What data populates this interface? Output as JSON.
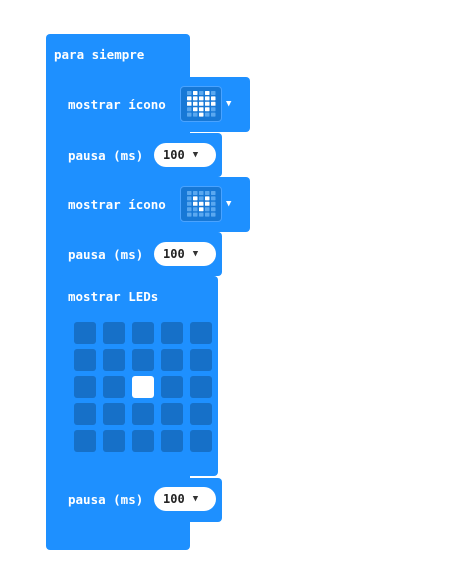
{
  "forever": {
    "label": "para siempre"
  },
  "blocks": [
    {
      "type": "show_icon",
      "label": "mostrar ícono",
      "icon": "heart-icon"
    },
    {
      "type": "pause",
      "label": "pausa (ms)",
      "value": "100"
    },
    {
      "type": "show_icon",
      "label": "mostrar ícono",
      "icon": "small-heart-icon"
    },
    {
      "type": "pause",
      "label": "pausa (ms)",
      "value": "100"
    },
    {
      "type": "show_leds",
      "label": "mostrar LEDs",
      "leds": [
        [
          0,
          0,
          0,
          0,
          0
        ],
        [
          0,
          0,
          0,
          0,
          0
        ],
        [
          0,
          0,
          1,
          0,
          0
        ],
        [
          0,
          0,
          0,
          0,
          0
        ],
        [
          0,
          0,
          0,
          0,
          0
        ]
      ]
    },
    {
      "type": "pause",
      "label": "pausa (ms)",
      "value": "100"
    }
  ],
  "colors": {
    "block": "#1e90ff",
    "led_off": "#1670c8",
    "led_on": "#ffffff"
  }
}
